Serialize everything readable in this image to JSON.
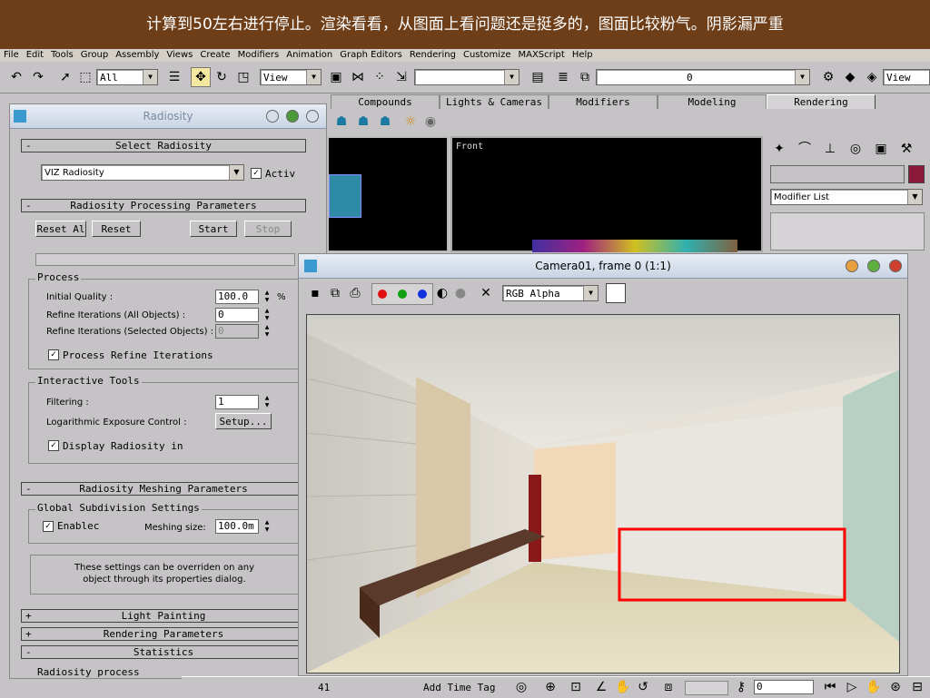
{
  "banner": {
    "text": "计算到50左右进行停止。渲染看看，从图面上看问题还是挺多的，图面比较粉气。阴影漏严重"
  },
  "menu": [
    "File",
    "Edit",
    "Tools",
    "Group",
    "Assembly",
    "Views",
    "Create",
    "Modifiers",
    "Animation",
    "Graph Editors",
    "Rendering",
    "Customize",
    "MAXScript",
    "Help"
  ],
  "toolbar": {
    "selection_filter": "All",
    "ref_coord": "View",
    "layer_value": "0",
    "right_view": "View"
  },
  "tabs": [
    {
      "label": "Compounds"
    },
    {
      "label": "Lights & Cameras"
    },
    {
      "label": "Modifiers"
    },
    {
      "label": "Modeling"
    },
    {
      "label": "Rendering"
    }
  ],
  "viewports": {
    "front_label": "Front"
  },
  "cmdpanel": {
    "modifier_list": "Modifier List",
    "color_swatch": "#8b1a3a"
  },
  "radiosity": {
    "title": "Radiosity",
    "select_header": "Select Radiosity",
    "engine": "VIZ Radiosity",
    "active_label": "Activ",
    "processing_header": "Radiosity Processing Parameters",
    "reset_all": "Reset Al",
    "reset": "Reset",
    "start": "Start",
    "stop": "Stop",
    "process_group": "Process",
    "initial_quality_label": "Initial Quality :",
    "initial_quality_value": "100.0",
    "percent": "%",
    "refine_all_label": "Refine Iterations (All Objects) :",
    "refine_all_value": "0",
    "refine_sel_label": "Refine Iterations (Selected Objects) :",
    "refine_sel_value": "0",
    "process_refine_label": "Process Refine Iterations",
    "interactive_group": "Interactive Tools",
    "filtering_label": "Filtering :",
    "filtering_value": "1",
    "log_exposure_label": "Logarithmic Exposure Control :",
    "setup_button": "Setup...",
    "display_radiosity_label": "Display Radiosity in",
    "meshing_header": "Radiosity Meshing Parameters",
    "global_subdiv": "Global Subdivision Settings",
    "enabled_label": "Enablec",
    "meshing_size_label": "Meshing size:",
    "meshing_size_value": "100.0m",
    "override_note_1": "These settings can be overriden on any",
    "override_note_2": "object through its properties dialog.",
    "light_painting": "Light Painting",
    "rendering_params": "Rendering Parameters",
    "statistics": "Statistics",
    "radiosity_process": "Radiosity process"
  },
  "camera_window": {
    "title": "Camera01, frame 0 (1:1)",
    "channel": "RGB Alpha"
  },
  "status": {
    "add_time_tag": "Add Time Tag",
    "frame_value": "0",
    "left_text": "41"
  }
}
